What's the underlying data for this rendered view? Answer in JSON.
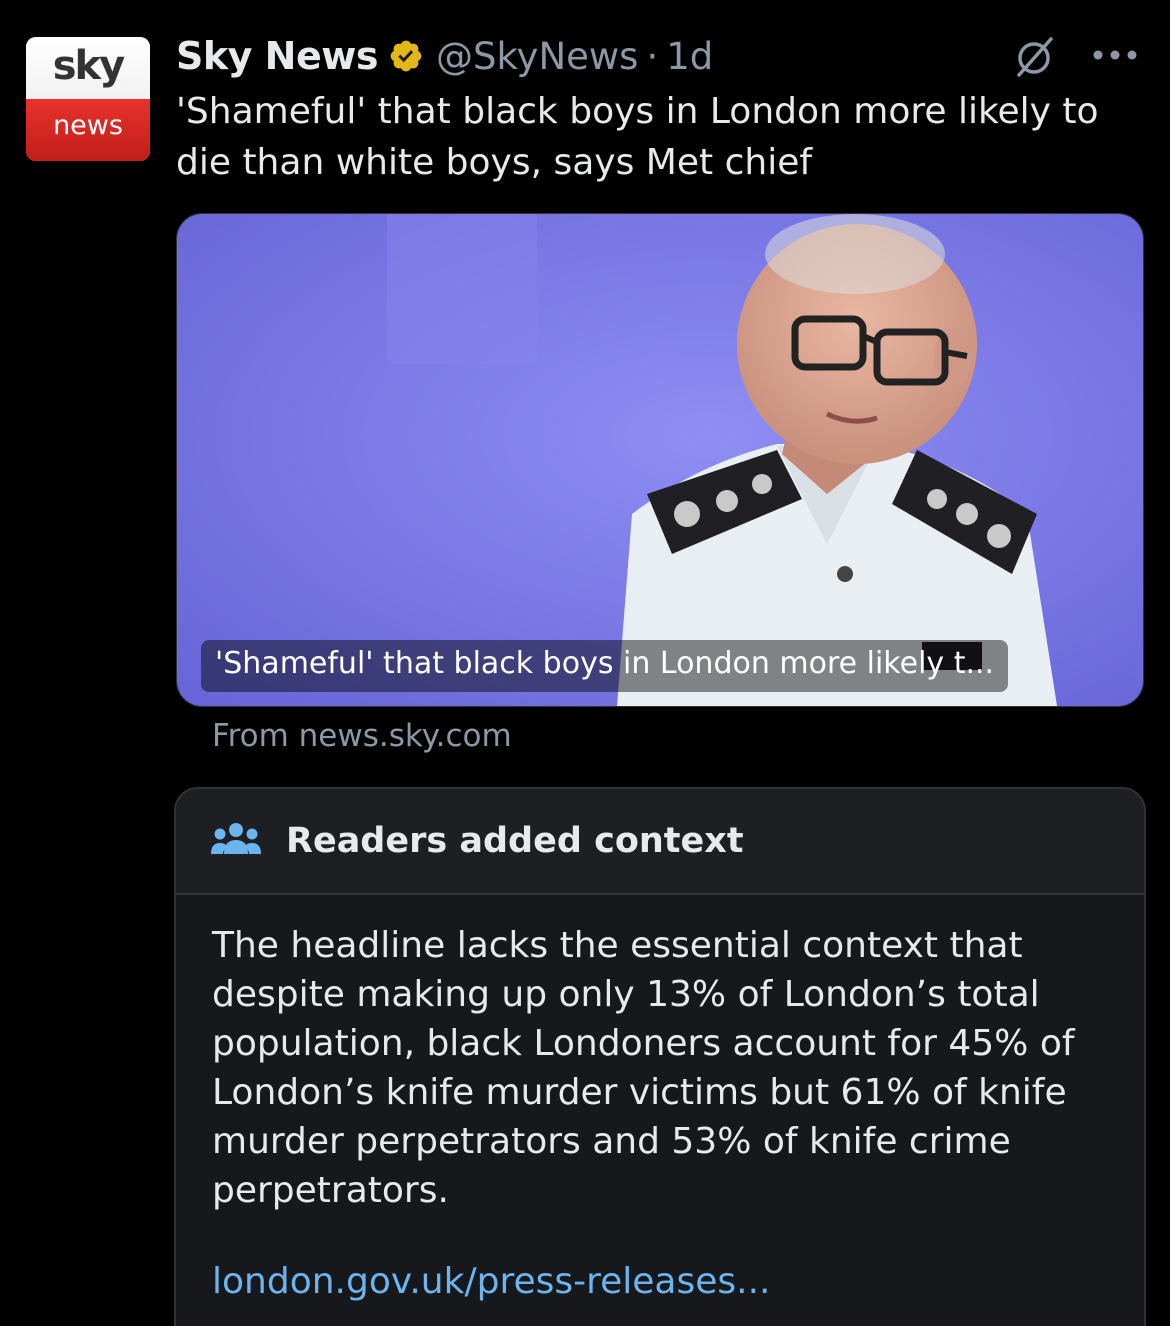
{
  "author": {
    "display_name": "Sky News",
    "handle": "@SkyNews",
    "separator": "·",
    "time": "1d",
    "avatar_top": "sky",
    "avatar_bottom": "news",
    "verified_color": "#e2b719"
  },
  "tweet": {
    "text": "'Shameful' that black boys in London more likely to die than white boys, says Met chief"
  },
  "card": {
    "caption": "'Shameful' that black boys in London more likely t...",
    "from": "From news.sky.com"
  },
  "note": {
    "icon": "people-icon",
    "title": "Readers added context",
    "body": "The headline lacks the essential context that despite making up only 13% of London’s total population, black Londoners account for 45% of London’s knife murder victims but 61% of knife murder perpetrators and 53% of knife crime perpetrators.",
    "link": "london.gov.uk/press-releases..."
  },
  "icons": {
    "grok": "grok-icon",
    "more": "more-icon"
  }
}
